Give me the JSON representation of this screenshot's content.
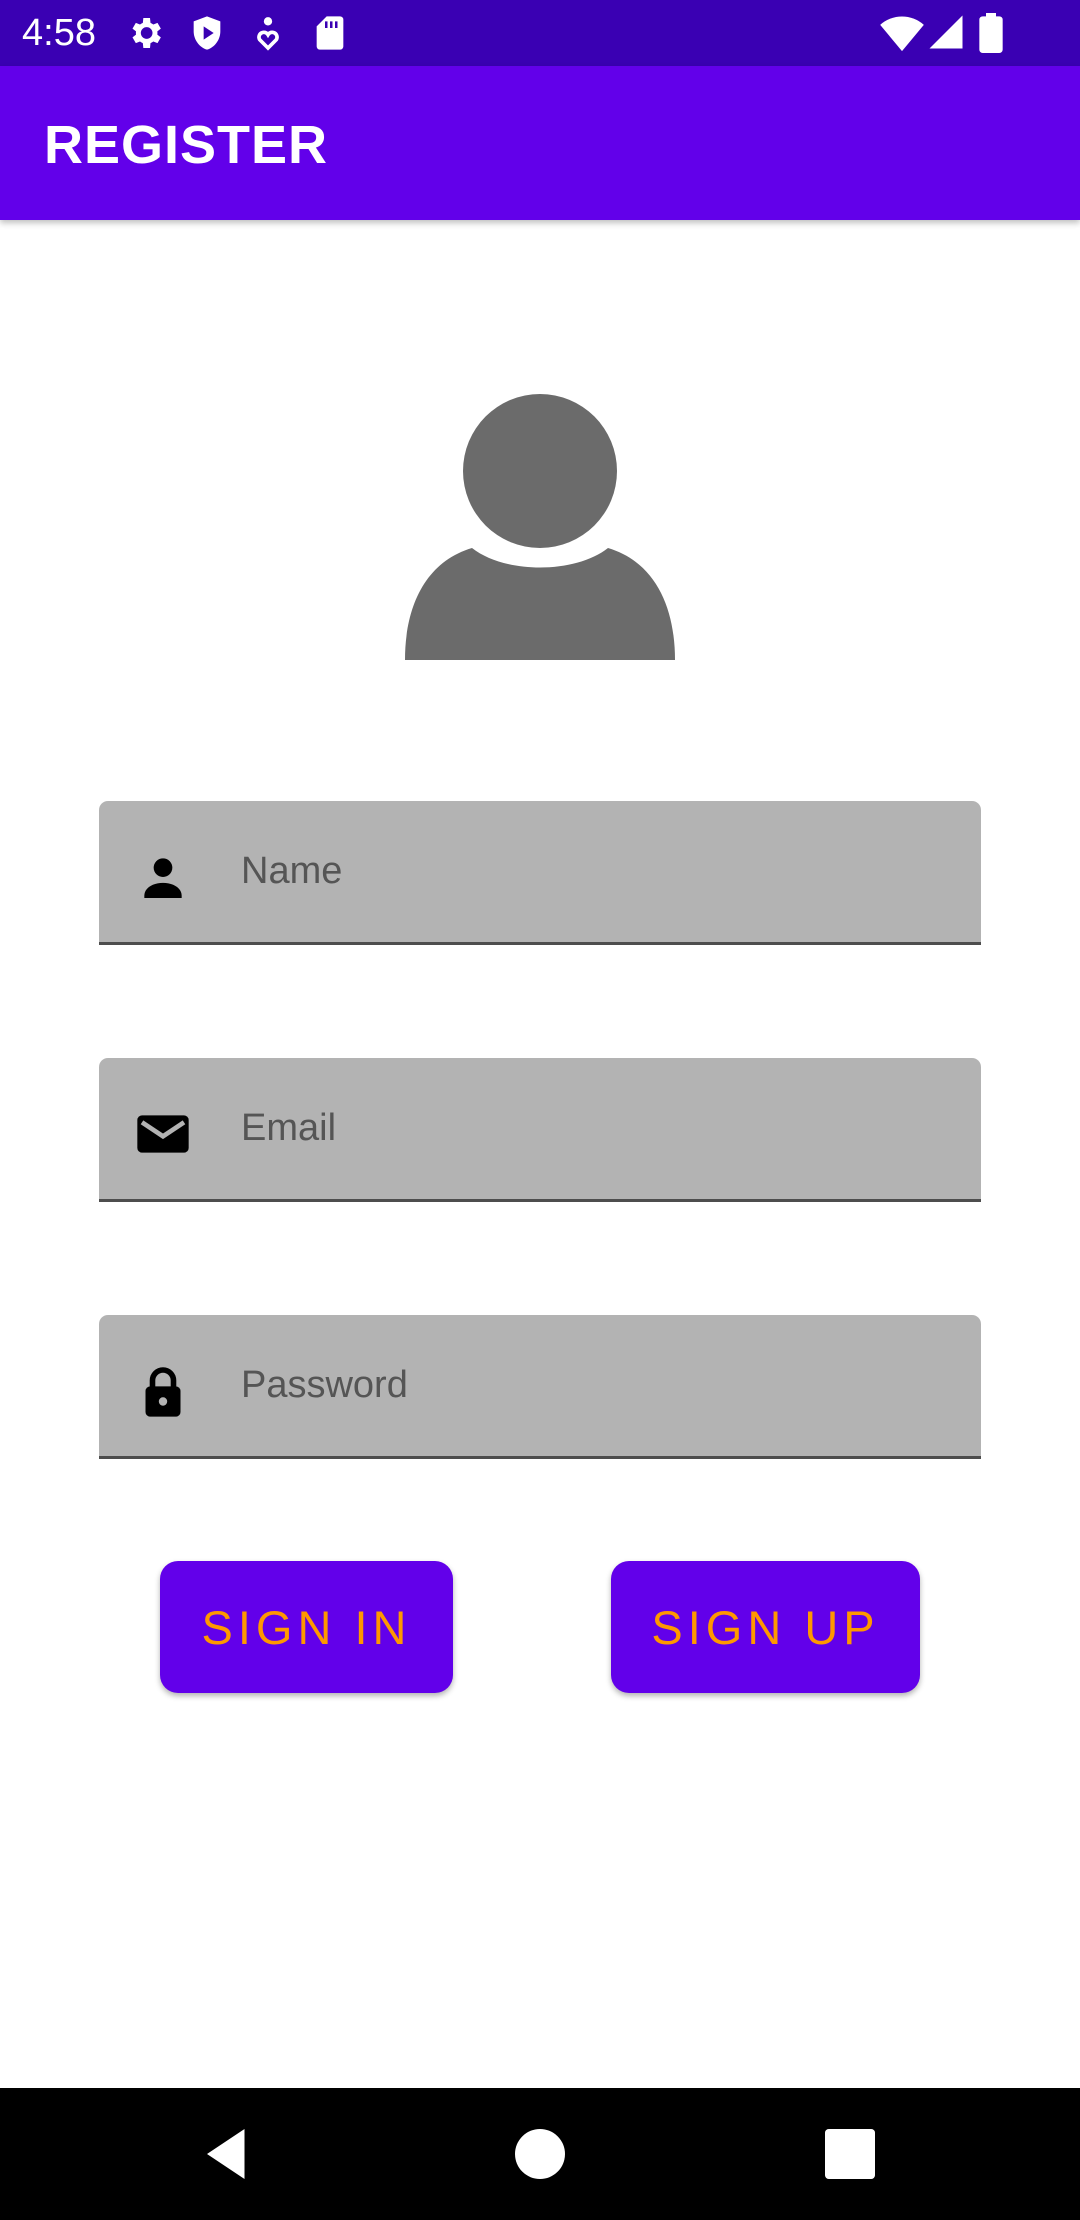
{
  "status_bar": {
    "time": "4:58",
    "icons": [
      "gear-icon",
      "shield-play-icon",
      "heart-signal-icon",
      "sd-card-icon",
      "wifi-icon",
      "cell-signal-icon",
      "battery-icon"
    ]
  },
  "app_bar": {
    "title": "REGISTER"
  },
  "form": {
    "name": {
      "placeholder": "Name",
      "value": "",
      "icon": "person-icon"
    },
    "email": {
      "placeholder": "Email",
      "value": "",
      "icon": "mail-icon"
    },
    "password": {
      "placeholder": "Password",
      "value": "",
      "icon": "lock-icon"
    }
  },
  "buttons": {
    "sign_in": "SIGN IN",
    "sign_up": "SIGN UP"
  },
  "colors": {
    "status_bar": "#3a00b3",
    "app_bar": "#6200ea",
    "button_bg": "#6200ea",
    "button_text": "#ff9800",
    "field_bg": "#b3b3b3",
    "avatar": "#6b6b6b"
  },
  "nav_bar": {
    "icons": [
      "back-icon",
      "home-icon",
      "recents-icon"
    ]
  }
}
